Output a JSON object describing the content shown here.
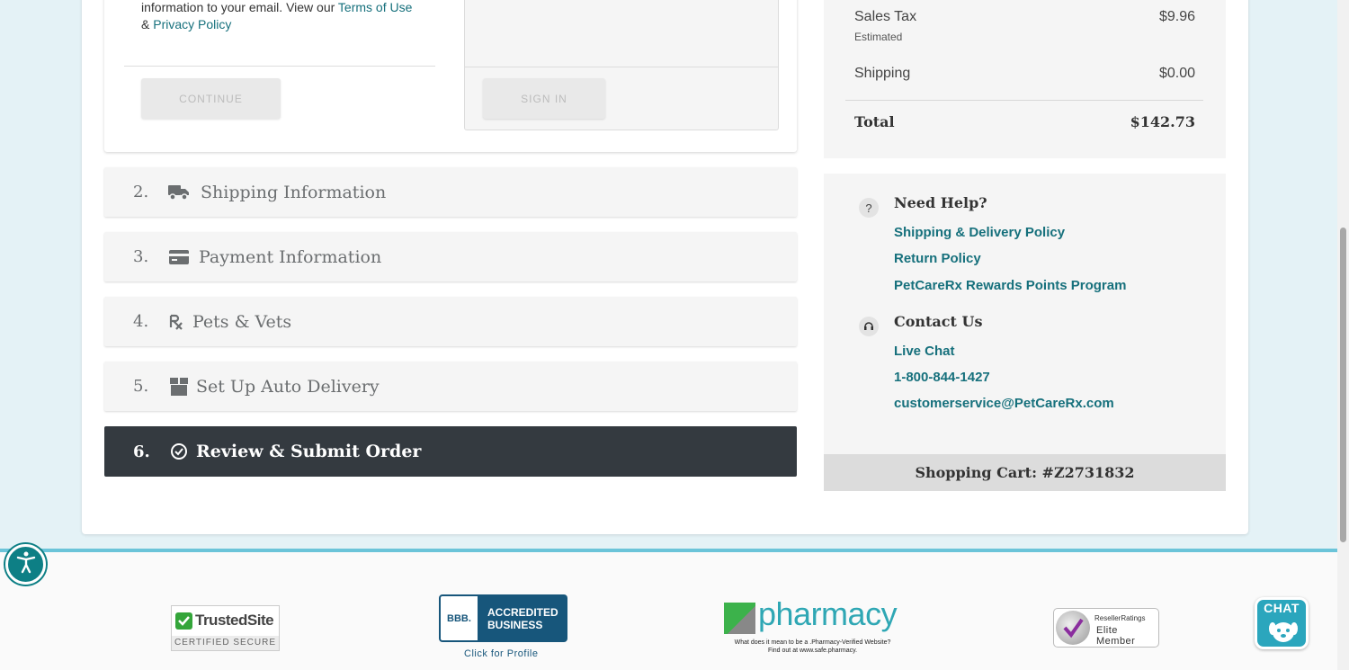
{
  "login": {
    "terms_prefix": "information to your email. View our ",
    "terms_link": "Terms of Use",
    "amp": "& ",
    "privacy_link": "Privacy Policy",
    "continue_label": "CONTINUE",
    "signin_label": "SIGN IN"
  },
  "steps": [
    {
      "num": "2.",
      "label": "Shipping Information",
      "icon": "truck-icon"
    },
    {
      "num": "3.",
      "label": "Payment Information",
      "icon": "credit-card-icon"
    },
    {
      "num": "4.",
      "label": "Pets & Vets",
      "icon": "rx-icon"
    },
    {
      "num": "5.",
      "label": "Set Up Auto Delivery",
      "icon": "box-icon"
    },
    {
      "num": "6.",
      "label": "Review & Submit Order",
      "icon": "check-circle-icon",
      "active": true
    }
  ],
  "summary": {
    "sales_tax_label": "Sales Tax",
    "sales_tax_value": "$9.96",
    "estimated": "Estimated",
    "shipping_label": "Shipping",
    "shipping_value": "$0.00",
    "total_label": "Total",
    "total_value": "$142.73"
  },
  "help": {
    "need_help": "Need Help?",
    "links": [
      "Shipping & Delivery Policy",
      "Return Policy",
      "PetCareRx Rewards Points Program"
    ],
    "contact_us": "Contact Us",
    "contact_links": [
      "Live Chat",
      "1-800-844-1427",
      "customerservice@PetCareRx.com"
    ],
    "question_mark": "?"
  },
  "cart": {
    "label": "Shopping Cart: #Z2731832"
  },
  "footer": {
    "trustedsite_name": "TrustedSite",
    "trustedsite_sub": "CERTIFIED SECURE",
    "bbb_text_1": "ACCREDITED",
    "bbb_text_2": "BUSINESS",
    "bbb_logo": "BBB.",
    "bbb_profile": "Click for Profile",
    "pharmacy_word": "pharmacy",
    "pharmacy_small_1": "What does it mean to be a .Pharmacy-Verified Website?",
    "pharmacy_small_2": "Find out at www.safe.pharmacy.",
    "reseller_top": "ResellerRatings",
    "reseller_bottom": "Elite Member",
    "chat_label": "CHAT"
  },
  "colors": {
    "accent_teal": "#16707c",
    "active_step_bg": "#343a40",
    "footer_line": "#6bc4d9"
  }
}
